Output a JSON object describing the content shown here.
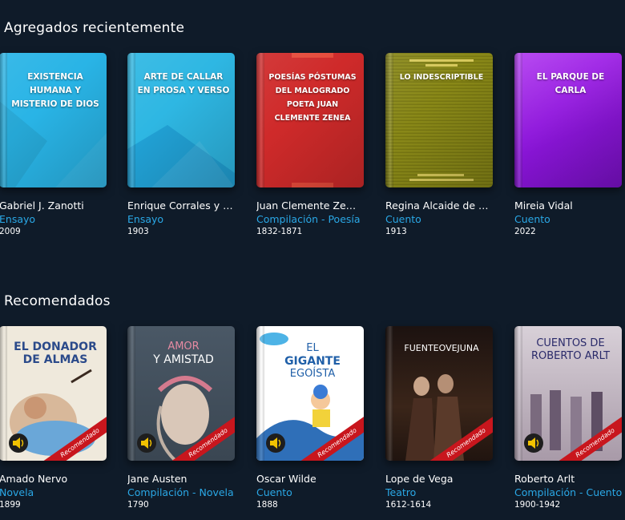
{
  "sections": {
    "recent": {
      "title": "Agregados recientemente",
      "books": [
        {
          "cover_title": "EXISTENCIA HUMANA Y MISTERIO DE DIOS",
          "author": "Gabriel J. Zanotti",
          "genre": "Ensayo",
          "year": "2009",
          "color": "#29b4e6"
        },
        {
          "cover_title": "ARTE DE CALLAR EN PROSA Y VERSO",
          "author": "Enrique Corrales y S…",
          "genre": "Ensayo",
          "year": "1903",
          "color": "#2eb7e3"
        },
        {
          "cover_title": "POESÍAS PÓSTUMAS DEL MALOGRADO POETA JUAN CLEMENTE ZENEA",
          "author": "Juan Clemente Zene…",
          "genre": "Compilación - Poesía",
          "year": "1832-1871",
          "color": "#cf2a2a"
        },
        {
          "cover_title": "LO INDESCRIPTIBLE",
          "author": "Regina Alcaide de Za…",
          "genre": "Cuento",
          "year": "1913",
          "color": "#8b8a16"
        },
        {
          "cover_title": "EL PARQUE DE CARLA",
          "author": "Mireia Vidal",
          "genre": "Cuento",
          "year": "2022",
          "color": "#9a1fe0"
        }
      ]
    },
    "recommended": {
      "title": "Recomendados",
      "ribbon_label": "Recomendado",
      "books": [
        {
          "cover_title": "EL DONADOR DE ALMAS",
          "author": "Amado Nervo",
          "genre": "Novela",
          "year": "1899",
          "color": "#efe9dc",
          "title_color": "#2b4a8a"
        },
        {
          "cover_title_1": "AMOR",
          "cover_title_2": "Y AMISTAD",
          "author": "Jane Austen",
          "genre": "Compilación - Novela",
          "year": "1790",
          "color": "#44505c",
          "title_color": "#ffffff"
        },
        {
          "cover_title_1": "EL",
          "cover_title_2": "GIGANTE",
          "cover_title_3": "EGOÍSTA",
          "author": "Oscar Wilde",
          "genre": "Cuento",
          "year": "1888",
          "color": "#ffffff",
          "title_color": "#1f5fa8"
        },
        {
          "cover_title": "FUENTEOVEJUNA",
          "author": "Lope de Vega",
          "genre": "Teatro",
          "year": "1612-1614",
          "color": "#2c1c16",
          "title_color": "#ffffff"
        },
        {
          "cover_title": "CUENTOS DE ROBERTO ARLT",
          "author": "Roberto Arlt",
          "genre": "Compilación - Cuento",
          "year": "1900-1942",
          "color": "#cfc6cf",
          "title_color": "#2a2a6a"
        }
      ]
    }
  }
}
